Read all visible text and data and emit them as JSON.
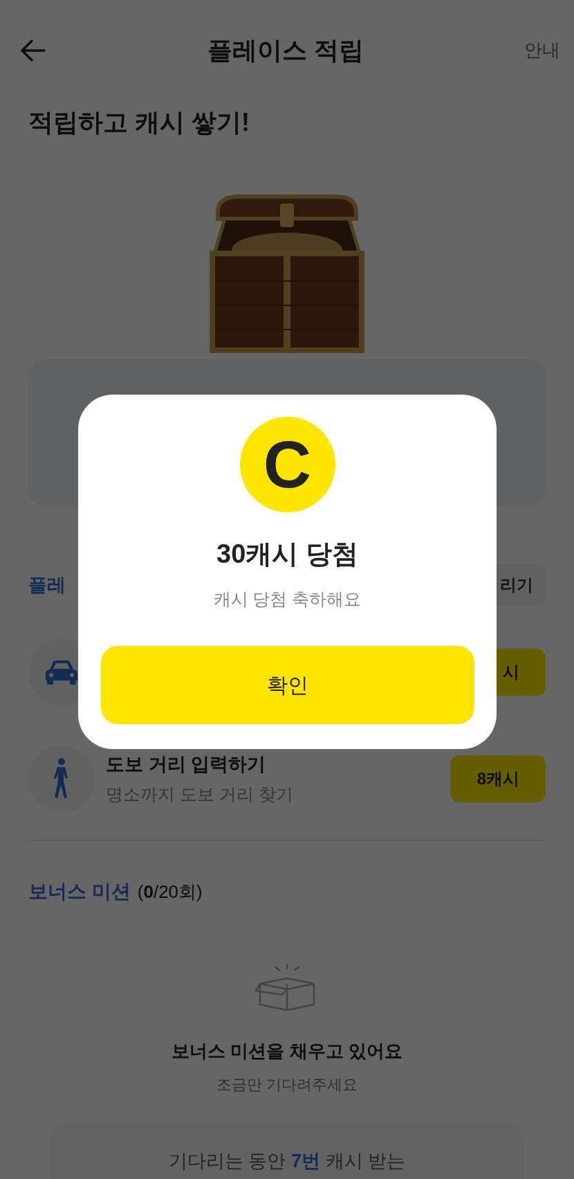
{
  "header": {
    "title": "플레이스 적립",
    "info_link": "안내"
  },
  "headline": "적립하고 캐시 쌓기!",
  "mission_section": {
    "title": "플레",
    "action": "리기",
    "missions": [
      {
        "kind": "car",
        "reward": "시"
      },
      {
        "kind": "walk",
        "title": "도보 거리 입력하기",
        "subtitle": "명소까지 도보 거리 찾기",
        "reward": "8캐시"
      }
    ]
  },
  "bonus_section": {
    "title": "보너스 미션",
    "count_open": "(",
    "count_done": "0",
    "count_rest": "/20회)",
    "empty_title": "보너스 미션을 채우고 있어요",
    "empty_subtitle": "조금만 기다려주세요",
    "card": {
      "prefix": "기다리는 동안",
      "highlight": "7번",
      "suffix": "캐시 받는"
    }
  },
  "dialog": {
    "coin_symbol": "C",
    "title": "30캐시 당첨",
    "message": "캐시 당첨 축하해요",
    "confirm": "확인"
  }
}
